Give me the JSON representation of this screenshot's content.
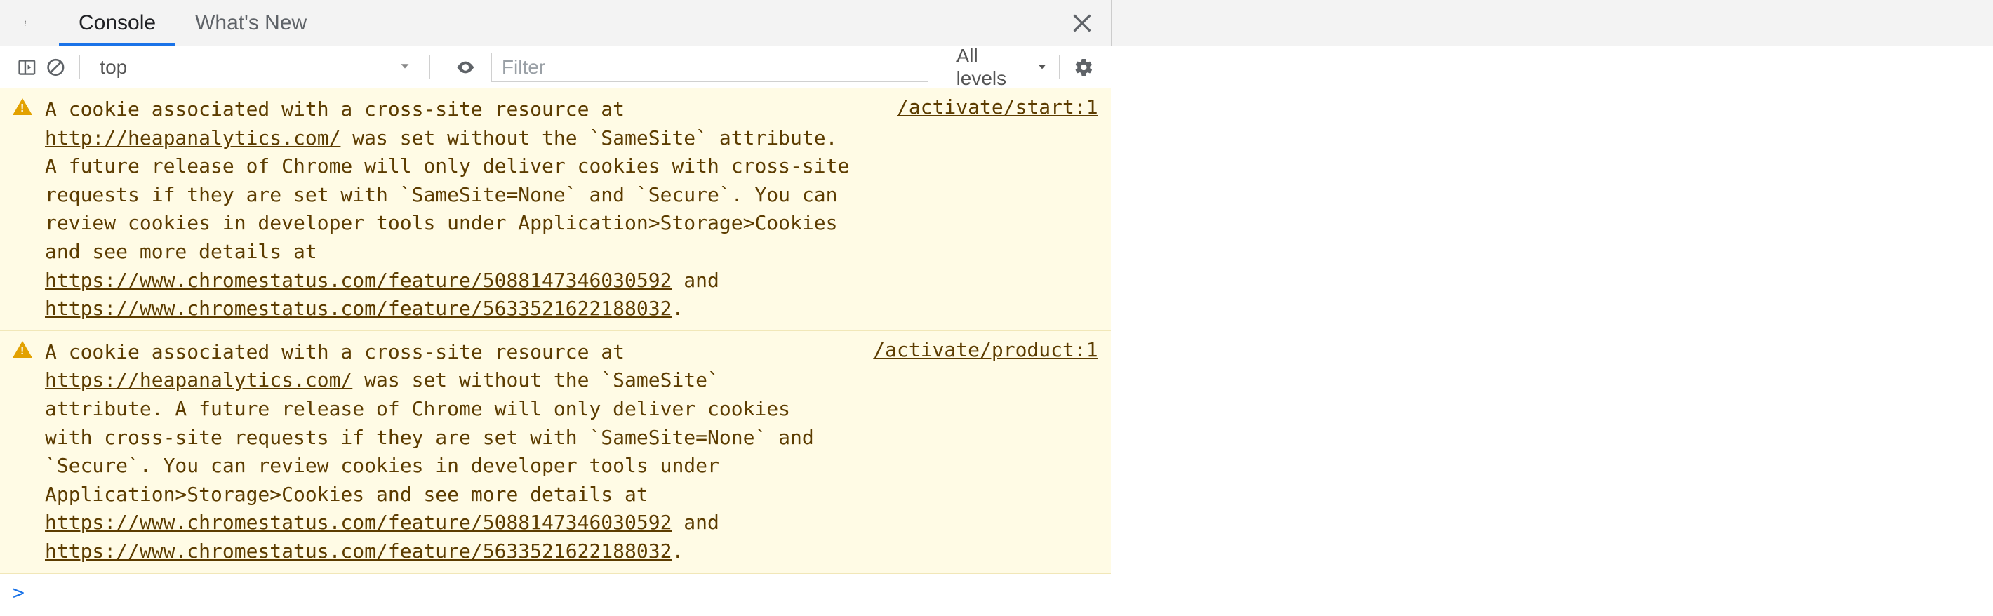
{
  "tabs": {
    "console": "Console",
    "whatsnew": "What's New"
  },
  "toolbar": {
    "context": "top",
    "filter_placeholder": "Filter",
    "levels": "All levels"
  },
  "entries": [
    {
      "pre1": "A cookie associated with a cross-site resource at ",
      "url1": "http://heapanalytics.com/",
      "mid1": " was set without the `SameSite` attribute. A future release of Chrome will only deliver cookies with cross-site requests if they are set with `SameSite=None` and `Secure`. You can review cookies in developer tools under Application>Storage>Cookies and see more details at ",
      "url2": "https://www.chromestatus.com/feature/5088147346030592",
      "mid2": " and ",
      "url3": "https://www.chromestatus.com/feature/5633521622188032",
      "post": ".",
      "source": "/activate/start:1"
    },
    {
      "pre1": "A cookie associated with a cross-site resource at ",
      "url1": "https://heapanalytics.com/",
      "mid1": " was set without the `SameSite` attribute. A future release of Chrome will only deliver cookies with cross-site requests if they are set with `SameSite=None` and `Secure`. You can review cookies in developer tools under Application>Storage>Cookies and see more details at ",
      "url2": "https://www.chromestatus.com/feature/5088147346030592",
      "mid2": " and ",
      "url3": "https://www.chromestatus.com/feature/5633521622188032",
      "post": ".",
      "source": "/activate/product:1"
    }
  ],
  "prompt": ">"
}
